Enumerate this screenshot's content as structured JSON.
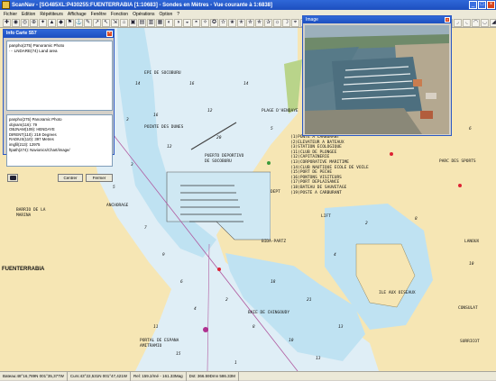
{
  "window": {
    "title": "ScanNav - [SG485XL:P430255:FUENTERRABIA [1:10683] - Sondes en Mètres - Vue courante à 1:6838]"
  },
  "window_buttons": {
    "minimize": "_",
    "maximize": "□",
    "close": "×"
  },
  "menu": [
    "Fichier",
    "Edition",
    "Répétiteurs",
    "Affichage",
    "Fenêtre",
    "Fonction",
    "Opérations",
    "Option",
    "?"
  ],
  "toolbar_icons": [
    "✚",
    "◉",
    "◎",
    "⊕",
    "✦",
    "▲",
    "◆",
    "⚑",
    "⚓",
    "✎",
    "↗",
    "↖",
    "⇲",
    "⌂",
    "▣",
    "▤",
    "▥",
    "▦",
    "◐",
    "◑",
    "◒",
    "◓",
    "✧",
    "✪",
    "✫",
    "✬",
    "✭",
    "✮",
    "✯",
    "✰",
    "☼",
    "☽",
    "⌖",
    "⊗",
    "⊘",
    "⊙",
    "◈",
    "◇",
    "◊",
    "○",
    "●",
    "◌",
    "◍",
    "◎",
    "◘",
    "◙",
    "◚",
    "◛",
    "◜",
    "◝",
    "◞",
    "◟",
    "◠",
    "◡",
    "◢",
    "◣",
    "◤",
    "◥",
    "◦"
  ],
  "info_panel": {
    "title": "Info Carte S57",
    "close": "×",
    "tree": [
      "panpho(275) Panoramic Photo",
      "··· LNDARE(74) Land area"
    ],
    "attributes": [
      "panpho(275) Panoramic Photo",
      "objnam(116): 79",
      "OBJNAM(109): HENDAYE",
      "DIRENT(110): 219 Degrees",
      "RADIUS(110): 397 Metres",
      "imgfil(213): 12975",
      "ftpath(274): Navionics/Chart/image/"
    ],
    "buttons": {
      "center": "Centrer",
      "close": "Fermer"
    }
  },
  "image_popup": {
    "title": "Image",
    "close": "×"
  },
  "map_labels": [
    {
      "text": "FUENTERRABIA",
      "big": true
    },
    {
      "text": "EPI DE SOCOBURU"
    },
    {
      "text": "POINTE DES DUNES"
    },
    {
      "text": "PUERTO DEPORTIVO"
    },
    {
      "text": "DE SOCOBURU"
    },
    {
      "text": "ANCHORAGE"
    },
    {
      "text": "BARRIO DE LA"
    },
    {
      "text": "MARINA"
    },
    {
      "text": "BAIE DE CHINGOUDY"
    },
    {
      "text": "PORTAL DE ESPANA"
    },
    {
      "text": "AMITRAMIO"
    },
    {
      "text": "PLAGE D'HENDAYE"
    },
    {
      "text": "POINTE DE CAROOL"
    },
    {
      "text": "PARC DES SPORTS"
    },
    {
      "text": "ILE AUX OISEAUX"
    },
    {
      "text": "LANOUX"
    },
    {
      "text": "CONSULAT"
    },
    {
      "text": "SURRICOT"
    },
    {
      "text": "BIDA-PARTZ"
    },
    {
      "text": "LIFT"
    },
    {
      "text": "DEPT"
    }
  ],
  "legend_lines": [
    "(1)PONTE A CARBURANT",
    "(2)ELEVATEUR A BATEAUX",
    "(3)STATION ECOLOGIQUE",
    "(11)CLUB DE PLONGEE",
    "(12)CAPITAINERIE",
    "(13)CORPORATIVE MARITIME",
    "(14)CLUB NAUTIQUE ECOLE DE VOILE",
    "(15)PORT DE PECHE",
    "(16)PONTONS VISITEURS",
    "(17)PORT DEPLAISANCE",
    "(18)BATEAU DE SAUVETAGE",
    "(19)POSTE A CARBURANT"
  ],
  "soundings": [
    "14",
    "16",
    "12",
    "3",
    "5",
    "7",
    "9",
    "6",
    "4",
    "2",
    "8",
    "10",
    "13",
    "11",
    "15",
    "1",
    "18",
    "21",
    "20"
  ],
  "statusbar": [
    "Bateau:48°16,789N 001°35,377W",
    "Curs:43°22,531N 001°47,421W",
    "Rel: 159.2/mé - 161.33Mag",
    "Dst: 366.59Dmn 586.33M"
  ],
  "colors": {
    "land": "#f6e6b4",
    "shallow": "#bfe2f2",
    "water": "#dfeef6",
    "title_blue": "#2f67d8"
  }
}
